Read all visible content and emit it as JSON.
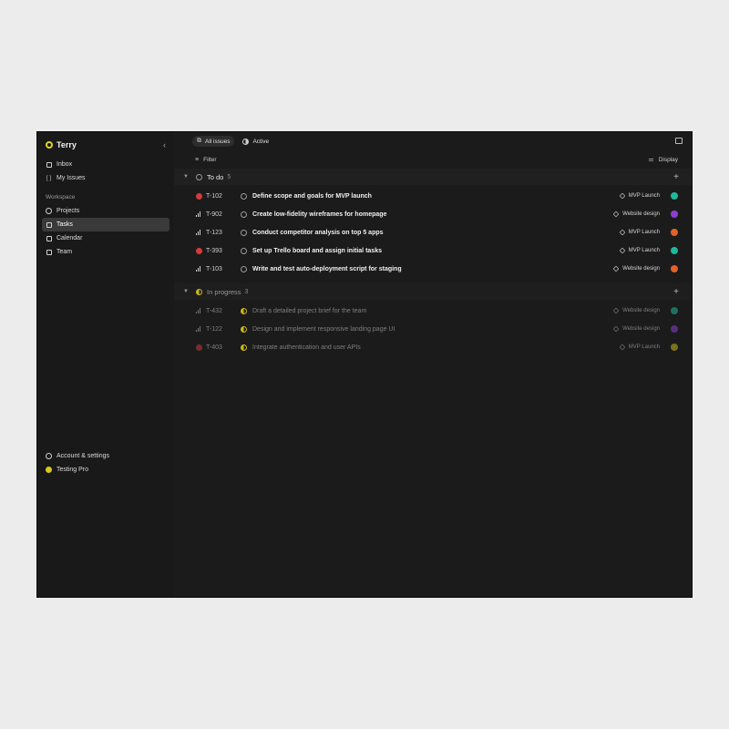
{
  "sidebar": {
    "brand": "Terry",
    "collapse_icon": "chevron-left-icon",
    "nav": [
      {
        "label": "Inbox",
        "icon": "inbox-icon"
      },
      {
        "label": "My Issues",
        "icon": "bracket-icon"
      }
    ],
    "workspace_label": "Workspace",
    "workspace_items": [
      {
        "label": "Projects",
        "icon": "cube-icon"
      },
      {
        "label": "Tasks",
        "icon": "tasks-icon",
        "active": true
      },
      {
        "label": "Calendar",
        "icon": "calendar-icon"
      },
      {
        "label": "Team",
        "icon": "team-icon"
      }
    ],
    "bottom": {
      "settings": "Account & settings",
      "plan": "Testing Pro"
    }
  },
  "topbar": {
    "tabs": [
      {
        "label": "All issues",
        "selected": true
      },
      {
        "label": "Active",
        "selected": false
      }
    ]
  },
  "filterbar": {
    "filter_label": "Filter",
    "display_label": "Display"
  },
  "groups": [
    {
      "name": "To do",
      "count": "5",
      "status": "todo",
      "rows": [
        {
          "id": "T-102",
          "title": "Define scope and goals for MVP launch",
          "priority": "urgent",
          "project": "MVP Launch",
          "avatar_color": "#1fb89a"
        },
        {
          "id": "T-902",
          "title": "Create low-fidelity wireframes for homepage",
          "priority": "bars",
          "project": "Website design",
          "avatar_color": "#8b3fd1"
        },
        {
          "id": "T-123",
          "title": "Conduct competitor analysis on top 5 apps",
          "priority": "bars",
          "project": "MVP Launch",
          "avatar_color": "#e0632b"
        },
        {
          "id": "T-393",
          "title": "Set up Trello board and assign initial tasks",
          "priority": "urgent",
          "project": "MVP Launch",
          "avatar_color": "#1fb89a"
        },
        {
          "id": "T-103",
          "title": "Write and test auto-deployment script for staging",
          "priority": "bars",
          "project": "Website design",
          "avatar_color": "#e0632b"
        }
      ]
    },
    {
      "name": "In progress",
      "count": "3",
      "status": "progress",
      "rows": [
        {
          "id": "T-432",
          "title": "Draft a detailed project brief for the team",
          "priority": "bars",
          "project": "Website design",
          "avatar_color": "#1fb89a"
        },
        {
          "id": "T-122",
          "title": "Design and implement responsive landing page UI",
          "priority": "bars",
          "project": "Website design",
          "avatar_color": "#8b3fd1"
        },
        {
          "id": "T-403",
          "title": "Integrate authentication and user APIs",
          "priority": "urgent",
          "project": "MVP Launch",
          "avatar_color": "#c9b81c"
        }
      ]
    }
  ]
}
